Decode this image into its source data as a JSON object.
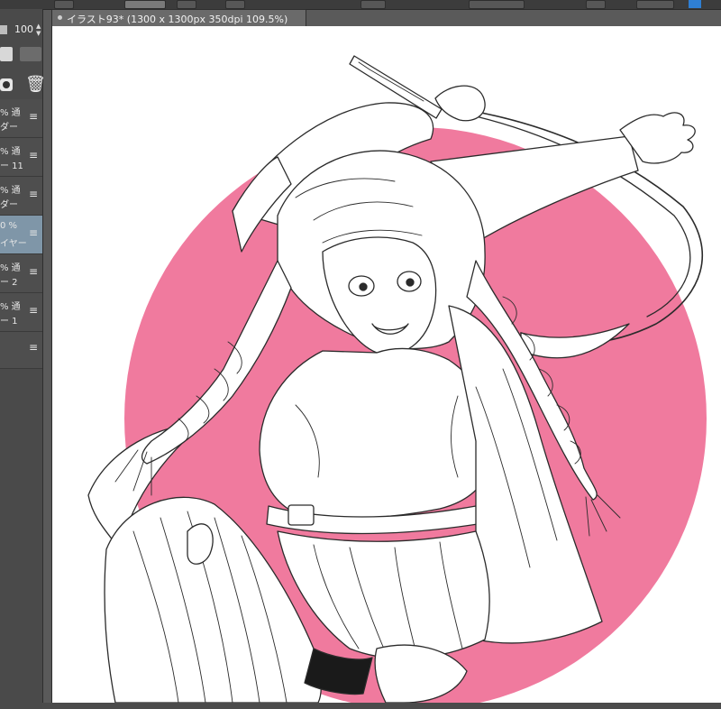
{
  "layers_panel": {
    "opacity_value": "100",
    "layers": [
      {
        "line1": "% 通",
        "line2": "ダー",
        "selected": false
      },
      {
        "line1": "% 通",
        "line2": "ー 11",
        "selected": false
      },
      {
        "line1": "% 通",
        "line2": "ダー",
        "selected": false
      },
      {
        "line1": "0 %",
        "line2": "イヤー",
        "selected": true
      },
      {
        "line1": "% 通",
        "line2": "ー 2",
        "selected": false
      },
      {
        "line1": "% 通",
        "line2": "ー 1",
        "selected": false
      }
    ],
    "menu_glyph": "≡"
  },
  "document": {
    "tab_title": "イラスト93* (1300 x 1300px 350dpi 109.5%)"
  },
  "canvas": {
    "background_color": "#ffffff",
    "circle_color": "#f07a9e",
    "line_color": "#2b2b2b"
  },
  "colors": {
    "selected_layer": "#7f96a8",
    "accent": "#2f7fd3"
  }
}
